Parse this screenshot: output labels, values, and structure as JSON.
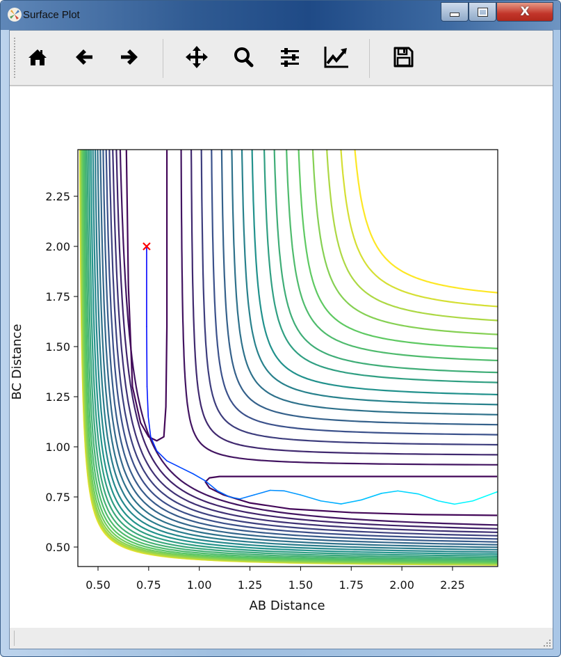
{
  "window": {
    "title": "Surface Plot",
    "icon": "matplotlib-icon"
  },
  "toolbar": {
    "buttons": [
      {
        "name": "home",
        "icon": "home-icon"
      },
      {
        "name": "back",
        "icon": "arrow-left-icon"
      },
      {
        "name": "forward",
        "icon": "arrow-right-icon"
      },
      {
        "name": "pan",
        "icon": "move-icon"
      },
      {
        "name": "zoom",
        "icon": "magnifier-icon"
      },
      {
        "name": "subplots",
        "icon": "sliders-icon"
      },
      {
        "name": "customize",
        "icon": "line-chart-icon"
      },
      {
        "name": "save",
        "icon": "floppy-disk-icon"
      }
    ]
  },
  "chart_data": {
    "type": "contour",
    "xlabel": "AB Distance",
    "ylabel": "BC Distance",
    "xlim": [
      0.4,
      2.47
    ],
    "ylim": [
      0.4,
      2.48
    ],
    "xticks": [
      "0.50",
      "0.75",
      "1.00",
      "1.25",
      "1.50",
      "1.75",
      "2.00",
      "2.25"
    ],
    "yticks": [
      "0.50",
      "0.75",
      "1.00",
      "1.25",
      "1.50",
      "1.75",
      "2.00",
      "2.25"
    ],
    "colormap": "viridis",
    "contour_families": {
      "outer_levels": {
        "edge_values": [
          0.91,
          0.96,
          1.01,
          1.06,
          1.11,
          1.16,
          1.21,
          1.26,
          1.32,
          1.37,
          1.43,
          1.49,
          1.56,
          1.63,
          1.7,
          1.77
        ],
        "curvature": [
          0.012,
          0.0147,
          0.0174,
          0.0201,
          0.0228,
          0.0255,
          0.0282,
          0.0309,
          0.0336,
          0.0363,
          0.039,
          0.0417,
          0.0444,
          0.0471,
          0.0498,
          0.0525
        ]
      },
      "wall_levels": {
        "count": 22,
        "inner_asymptote": 0.56,
        "outer_asymptote": 0.4,
        "inner_curvature": 0.095,
        "outer_curvature": 0.0225
      }
    },
    "entrance_valley_contour": [
      [
        0.64,
        2.48
      ],
      [
        0.65,
        1.8
      ],
      [
        0.67,
        1.3
      ],
      [
        0.71,
        1.12
      ],
      [
        0.75,
        1.05
      ],
      [
        0.79,
        1.03
      ],
      [
        0.825,
        1.05
      ],
      [
        0.835,
        1.2
      ],
      [
        0.84,
        1.6
      ],
      [
        0.84,
        2.48
      ]
    ],
    "exit_valley_contour": [
      [
        2.47,
        0.852
      ],
      [
        1.5,
        0.852
      ],
      [
        1.1,
        0.852
      ],
      [
        1.05,
        0.845
      ],
      [
        1.03,
        0.825
      ],
      [
        1.05,
        0.795
      ],
      [
        1.12,
        0.76
      ],
      [
        1.25,
        0.72
      ],
      [
        1.45,
        0.69
      ],
      [
        1.75,
        0.672
      ],
      [
        2.1,
        0.662
      ],
      [
        2.47,
        0.658
      ]
    ],
    "trajectory": {
      "color_start": "#0000ff",
      "color_end": "#00ffff",
      "points": [
        [
          0.74,
          2.0
        ],
        [
          0.74,
          1.6
        ],
        [
          0.742,
          1.3
        ],
        [
          0.748,
          1.15
        ],
        [
          0.76,
          1.05
        ],
        [
          0.79,
          0.98
        ],
        [
          0.84,
          0.93
        ],
        [
          0.9,
          0.9
        ],
        [
          0.97,
          0.865
        ],
        [
          1.03,
          0.83
        ],
        [
          1.09,
          0.78
        ],
        [
          1.15,
          0.75
        ],
        [
          1.2,
          0.74
        ],
        [
          1.27,
          0.76
        ],
        [
          1.35,
          0.783
        ],
        [
          1.42,
          0.78
        ],
        [
          1.5,
          0.76
        ],
        [
          1.6,
          0.73
        ],
        [
          1.7,
          0.715
        ],
        [
          1.8,
          0.735
        ],
        [
          1.9,
          0.768
        ],
        [
          1.98,
          0.78
        ],
        [
          2.08,
          0.765
        ],
        [
          2.18,
          0.73
        ],
        [
          2.26,
          0.714
        ],
        [
          2.35,
          0.73
        ],
        [
          2.47,
          0.775
        ]
      ]
    },
    "start_marker": {
      "x": 0.74,
      "y": 2.0,
      "symbol": "x",
      "color": "#ff0000"
    }
  }
}
